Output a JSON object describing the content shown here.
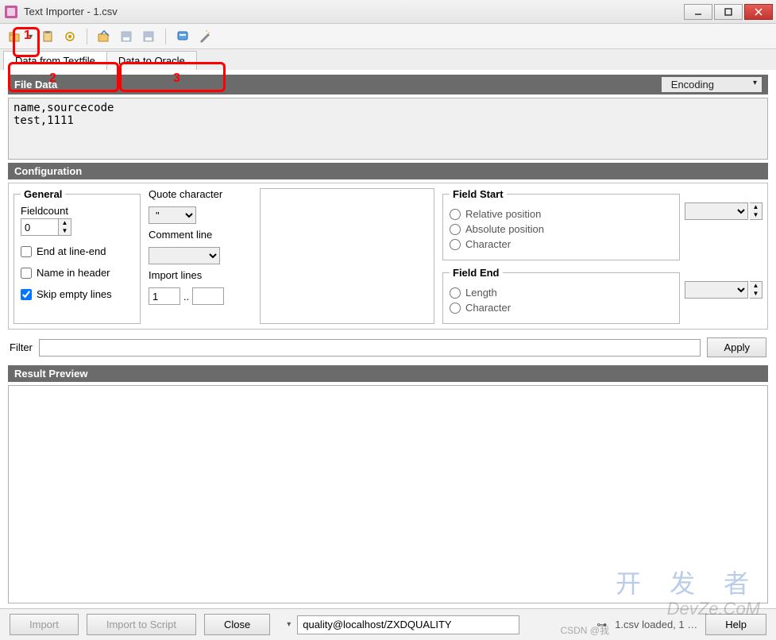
{
  "window": {
    "title": "Text Importer - 1.csv"
  },
  "tabs": {
    "t1": "Data from Textfile",
    "t2": "Data to Oracle"
  },
  "filedata": {
    "header": "File Data",
    "encoding_label": "Encoding",
    "content": "name,sourcecode\ntest,1111"
  },
  "configuration": {
    "header": "Configuration",
    "general": {
      "legend": "General",
      "fieldcount_label": "Fieldcount",
      "fieldcount_value": "0",
      "end_at_line_end": "End at line-end",
      "name_in_header": "Name in header",
      "skip_empty_lines": "Skip empty lines"
    },
    "quote": {
      "quote_label": "Quote character",
      "quote_value": "\"",
      "comment_label": "Comment line",
      "comment_value": "",
      "import_lines_label": "Import lines",
      "import_lines_from": "1",
      "import_lines_sep": "..",
      "import_lines_to": ""
    },
    "field_start": {
      "legend": "Field Start",
      "relative": "Relative position",
      "absolute": "Absolute position",
      "character": "Character"
    },
    "field_end": {
      "legend": "Field End",
      "length": "Length",
      "character": "Character"
    }
  },
  "filter": {
    "label": "Filter",
    "value": "",
    "apply": "Apply"
  },
  "result": {
    "header": "Result Preview"
  },
  "bottom": {
    "import": "Import",
    "import_script": "Import to Script",
    "close": "Close",
    "connection": "quality@localhost/ZXDQUALITY",
    "status": "1.csv loaded, 1 … ",
    "help": "Help"
  },
  "annotations": {
    "a1": "1",
    "a2": "2",
    "a3": "3"
  },
  "watermark": {
    "w1": "开 发 者",
    "w2": "DevZe.CoM",
    "w3": "CSDN @我"
  }
}
